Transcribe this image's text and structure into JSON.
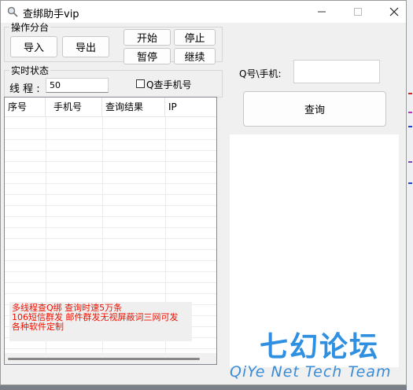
{
  "window": {
    "title": "查绑助手vip",
    "title_icon": "search-icon",
    "controls": [
      "minimize-icon",
      "maximize-icon",
      "close-icon"
    ]
  },
  "ops": {
    "legend": "操作分台",
    "import_label": "导入",
    "export_label": "导出",
    "start_label": "开始",
    "stop_label": "停止",
    "pause_label": "暂停",
    "resume_label": "继续"
  },
  "status": {
    "legend": "实时状态",
    "threads_label": "线 程 :",
    "threads_value": "50",
    "q_checkbox_label": "Q查手机号",
    "q_checkbox_checked": false
  },
  "query": {
    "label": "Q号\\手机:",
    "input_value": "",
    "button_label": "查询"
  },
  "table": {
    "columns": [
      "序号",
      "手机号",
      "查询结果",
      "IP"
    ]
  },
  "ad_text": {
    "line1": "多线程查Q绑 查询时速5万条",
    "line2": "106短信群发 邮件群发无视屏蔽词三网可发",
    "line3": "各种软件定制"
  },
  "watermark": {
    "title": "七幻论坛",
    "subtitle": "QiYe Net Tech Team"
  },
  "colors": {
    "ad_text": "#ee1100",
    "watermark": "#2f8fe0"
  }
}
